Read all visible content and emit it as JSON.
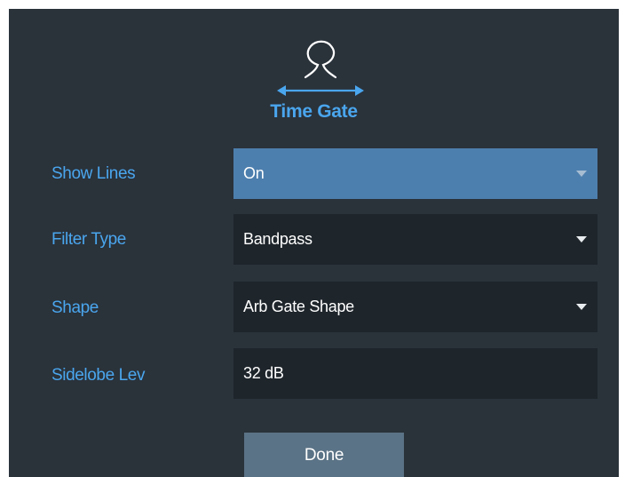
{
  "dialog": {
    "title": "Time Gate",
    "icon": "time-gate-loop-icon",
    "accent_color": "#4aa6ee",
    "background_color": "#2a323a"
  },
  "fields": {
    "show_lines": {
      "label": "Show Lines",
      "value": "On",
      "active": true
    },
    "filter_type": {
      "label": "Filter Type",
      "value": "Bandpass"
    },
    "shape": {
      "label": "Shape",
      "value": "Arb Gate Shape"
    },
    "sidelobe_lev": {
      "label": "Sidelobe Lev",
      "value": "32 dB"
    }
  },
  "actions": {
    "done_label": "Done"
  }
}
